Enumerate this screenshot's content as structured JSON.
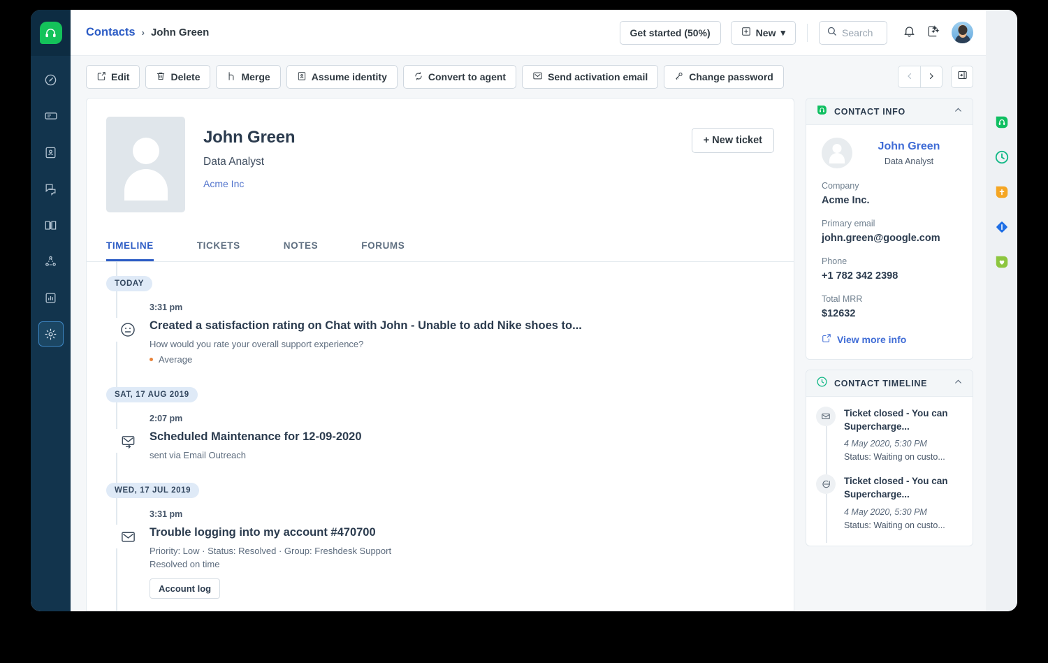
{
  "leftnav": {
    "logo": "headset-logo",
    "items": [
      {
        "name": "dashboard",
        "icon": "gauge-icon"
      },
      {
        "name": "tickets",
        "icon": "ticket-icon"
      },
      {
        "name": "contacts",
        "icon": "contact-card-icon"
      },
      {
        "name": "chat",
        "icon": "chat-icon"
      },
      {
        "name": "solutions",
        "icon": "book-icon"
      },
      {
        "name": "automations",
        "icon": "network-icon"
      },
      {
        "name": "reports",
        "icon": "bar-chart-icon"
      },
      {
        "name": "admin",
        "icon": "gear-icon",
        "active": true
      }
    ]
  },
  "header": {
    "breadcrumb_link": "Contacts",
    "breadcrumb_separator": "›",
    "breadcrumb_current": "John Green",
    "get_started_label": "Get started (50%)",
    "new_label": "New",
    "new_caret": "⌄",
    "search_placeholder": "Search",
    "icons": [
      "search-icon",
      "bell-icon",
      "sparkle-icon",
      "user-avatar"
    ]
  },
  "actionbar": {
    "buttons": [
      {
        "label": "Edit",
        "icon": "pencil-square-icon"
      },
      {
        "label": "Delete",
        "icon": "trash-icon"
      },
      {
        "label": "Merge",
        "icon": "merge-icon"
      },
      {
        "label": "Assume identity",
        "icon": "identity-card-icon"
      },
      {
        "label": "Convert to agent",
        "icon": "refresh-icon"
      },
      {
        "label": "Send activation email",
        "icon": "envelope-check-icon"
      },
      {
        "label": "Change password",
        "icon": "key-icon"
      }
    ],
    "prev_icon": "chevron-left-icon",
    "next_icon": "chevron-right-icon",
    "panel_toggle_icon": "sidebar-toggle-icon"
  },
  "contact": {
    "name": "John Green",
    "title": "Data Analyst",
    "company": "Acme Inc",
    "new_ticket_label": "+ New ticket"
  },
  "tabs": [
    {
      "label": "TIMELINE",
      "active": true
    },
    {
      "label": "TICKETS",
      "active": false
    },
    {
      "label": "NOTES",
      "active": false
    },
    {
      "label": "FORUMS",
      "active": false
    }
  ],
  "timeline": [
    {
      "day": "TODAY",
      "time": "3:31 pm",
      "icon": "neutral-face-icon",
      "title": "Created a satisfaction rating on Chat with John - Unable to add Nike shoes to...",
      "sub": "How would you rate your overall support experience?",
      "rating": "Average",
      "rating_color": "#e8833a"
    },
    {
      "day": "SAT, 17 AUG 2019",
      "time": "2:07 pm",
      "icon": "email-sent-icon",
      "title": "Scheduled Maintenance for 12-09-2020",
      "sub": "sent via Email Outreach"
    },
    {
      "day": "WED, 17 JUL 2019",
      "time": "3:31 pm",
      "icon": "envelope-icon",
      "title": "Trouble logging into my account #470700",
      "sub": "Priority: Low  ·  Status: Resolved  ·  Group: Freshdesk Support",
      "sub2": "Resolved on time",
      "chip": "Account log"
    }
  ],
  "contact_info": {
    "panel_title": "CONTACT INFO",
    "panel_icon": "freshdesk-shield-icon",
    "collapse_icon": "chevron-up-icon",
    "name": "John Green",
    "role": "Data Analyst",
    "fields": [
      {
        "label": "Company",
        "value": "Acme Inc."
      },
      {
        "label": "Primary email",
        "value": "john.green@google.com"
      },
      {
        "label": "Phone",
        "value": "+1 782 342 2398"
      },
      {
        "label": "Total MRR",
        "value": "$12632"
      }
    ],
    "more_link": "View more info",
    "more_icon": "external-link-icon"
  },
  "contact_timeline": {
    "panel_title": "CONTACT TIMELINE",
    "panel_icon": "clock-icon",
    "collapse_icon": "chevron-up-icon",
    "items": [
      {
        "icon": "envelope-icon",
        "title": "Ticket closed - You can Supercharge...",
        "date": "4 May 2020, 5:30 PM",
        "status": "Status: Waiting on custo..."
      },
      {
        "icon": "chat-bubble-icon",
        "title": "Ticket closed - You can Supercharge...",
        "date": "4 May 2020, 5:30 PM",
        "status": "Status: Waiting on custo..."
      }
    ]
  },
  "iconstrip": [
    {
      "name": "freshdesk-icon",
      "color": "#0fbf61"
    },
    {
      "name": "freshchat-clock-icon",
      "color": "#12b886"
    },
    {
      "name": "freshcaller-icon",
      "color": "#f5a623"
    },
    {
      "name": "freshsales-icon",
      "color": "#1f6fe5"
    },
    {
      "name": "freshmarketer-icon",
      "color": "#8dc63f"
    }
  ]
}
